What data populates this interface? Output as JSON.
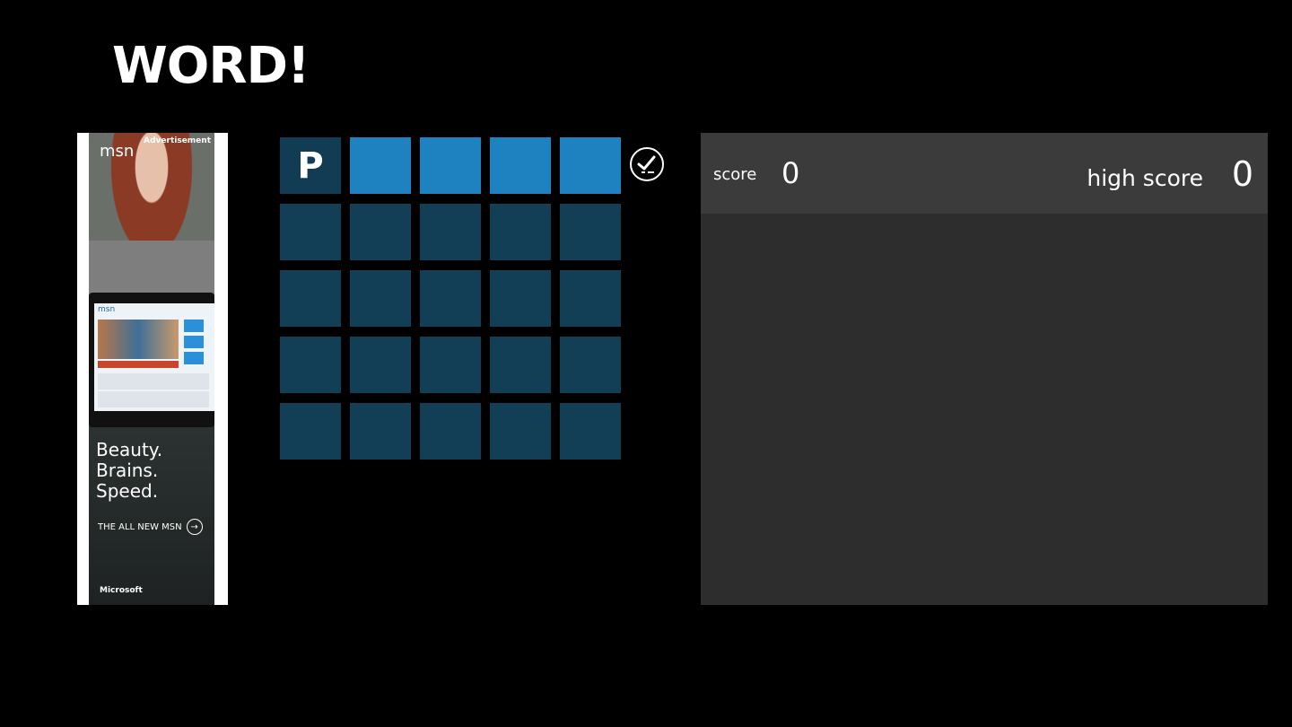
{
  "app": {
    "title": "WORD!"
  },
  "ad": {
    "label": "Advertisement",
    "brand": "msn",
    "copy_line1": "Beauty.",
    "copy_line2": "Brains.",
    "copy_line3": "Speed.",
    "cta": "THE ALL NEW MSN",
    "sponsor": "Microsoft"
  },
  "board": {
    "rows": 5,
    "columns": 5,
    "active_row": 0,
    "letters": [
      [
        "P",
        "",
        "",
        "",
        ""
      ],
      [
        "",
        "",
        "",
        "",
        ""
      ],
      [
        "",
        "",
        "",
        "",
        ""
      ],
      [
        "",
        "",
        "",
        "",
        ""
      ],
      [
        "",
        "",
        "",
        "",
        ""
      ]
    ],
    "colors": {
      "active": "#1e82c0",
      "inactive": "#123f56"
    },
    "submit_icon": "check-circle-icon"
  },
  "scoreboard": {
    "score_label": "score",
    "score": "0",
    "high_score_label": "high score",
    "high_score": "0"
  }
}
